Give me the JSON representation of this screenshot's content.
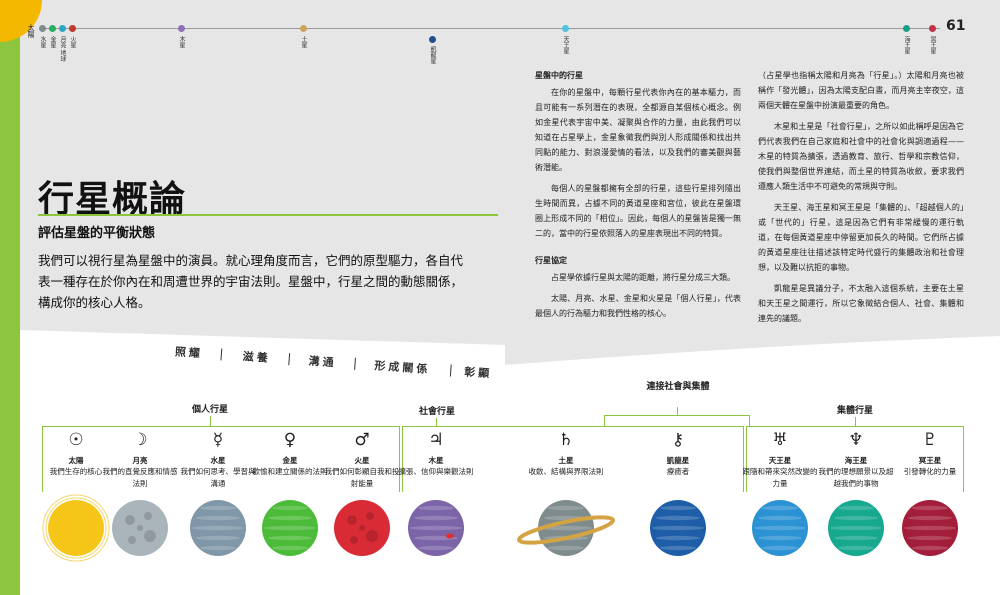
{
  "page_number": "61",
  "orbit_bar": {
    "sun_label": "太陽",
    "planets": [
      {
        "label": "水星",
        "color": "#7f8c8d"
      },
      {
        "label": "金星",
        "color": "#27ae60"
      },
      {
        "label": "月亮 地球",
        "color": "#2ba8c0"
      },
      {
        "label": "火星",
        "color": "#c0392b"
      },
      {
        "label": "木星",
        "color": "#8e6fb2"
      },
      {
        "label": "土星",
        "color": "#c9a659"
      },
      {
        "label": "凱龍星",
        "color": "#1f4f8c"
      },
      {
        "label": "天王星",
        "color": "#4fc3e0"
      },
      {
        "label": "海王星",
        "color": "#16a085"
      },
      {
        "label": "冥王星",
        "color": "#c0304a"
      }
    ]
  },
  "title": "行星概論",
  "subtitle": "評估星盤的平衡狀態",
  "intro": "我們可以視行星為星盤中的演員。就心理角度而言，它們的原型驅力，各自代表一種存在於你內在和周遭世界的宇宙法則。星盤中，行星之間的動態關係，構成你的核心人格。",
  "col1": {
    "heading1": "星盤中的行星",
    "p1": "在你的星盤中，每顆行星代表你內在的基本驅力，而且可能有一系列潛在的表現，全都源自某個核心概念。例如金星代表宇宙中美、凝聚與合作的力量，由此我們可以知道在占星學上，金星象徵我們與別人形成關係和找出共同點的能力、對浪漫愛情的看法，以及我們的審美觀與藝術潛能。",
    "p2": "每個人的星盤都擁有全部的行星，這些行星排列隨出生時間而異，占據不同的黃道星座和宮位，彼此在星盤環圈上形成不同的「相位」。因此，每個人的星盤皆是獨一無二的，當中的行星依照落入的星座表現出不同的特質。",
    "heading2": "行星協定",
    "p3": "占星學依據行星與太陽的距離，將行星分成三大類。",
    "p4": "太陽、月亮、水星、金星和火星是「個人行星」，代表最個人的行為驅力和我們性格的核心。"
  },
  "col2": {
    "p1": "（占星學也指稱太陽和月亮為「行星」。）太陽和月亮也被稱作「發光體」，因為太陽支配白晝，而月亮主宰夜空，這兩個天體在星盤中扮演最重要的角色。",
    "p2": "木星和土星是「社會行星」，之所以如此稱呼是因為它們代表我們在自己家庭和社會中的社會化與調適過程——木星的特質為擴張，透過教育、旅行、哲學和宗教信仰，使我們與整個世界連結，而土星的特質為收斂，要求我們遵應人類生活中不可避免的常規與守則。",
    "p3": "天王星、海王星和冥王星是「集體的」、「超越個人的」或「世代的」行星，這是因為它們有非常緩慢的運行軌道，在每個黃道星座中停留更加長久的時間。它們所占據的黃道星座往往描述該特定時代盛行的集體政治和社會理想，以及難以抗拒的事物。",
    "p4": "凱龍星是異議分子，不太融入這個系統，主要在土星和天王星之間運行，所以它象徵結合個人、社會、集體和連先的議題。"
  },
  "tabs": [
    "照耀",
    "滋養",
    "溝通",
    "形成關係",
    "彰顯"
  ],
  "groups": {
    "personal": "個人行星",
    "social": "社會行星",
    "connect": "連接社會與集體",
    "collective": "集體行星"
  },
  "diagram_planets": [
    {
      "symbol": "☉",
      "name": "太陽",
      "desc": "我們生存的核心",
      "color": "#f5c518"
    },
    {
      "symbol": "☽",
      "name": "月亮",
      "desc": "我們的直覺反應和情感法則",
      "color": "#aab4bb"
    },
    {
      "symbol": "☿",
      "name": "水星",
      "desc": "我們如何思考、學習與溝通",
      "color": "#7f97a8"
    },
    {
      "symbol": "♀",
      "name": "金星",
      "desc": "歡愉和建立關係的法則",
      "color": "#4cbb3a"
    },
    {
      "symbol": "♂",
      "name": "火星",
      "desc": "我們如何彰顯自我和投射能量",
      "color": "#d92b35"
    },
    {
      "symbol": "♃",
      "name": "木星",
      "desc": "擴張、信仰與樂觀法則",
      "color": "#7b64a8"
    },
    {
      "symbol": "♄",
      "name": "土星",
      "desc": "收斂、結構與界限法則",
      "color": "#7f8c8d"
    },
    {
      "symbol": "⚷",
      "name": "凱龍星",
      "desc": "療癒者",
      "color": "#1e5ea8"
    },
    {
      "symbol": "♅",
      "name": "天王星",
      "desc": "跟隨和帶來突然改變的力量",
      "color": "#2b92d4"
    },
    {
      "symbol": "♆",
      "name": "海王星",
      "desc": "我們的理想願景以及超越我們的事物",
      "color": "#17a890"
    },
    {
      "symbol": "♇",
      "name": "冥王星",
      "desc": "引發轉化的力量",
      "color": "#a31e3a"
    }
  ]
}
